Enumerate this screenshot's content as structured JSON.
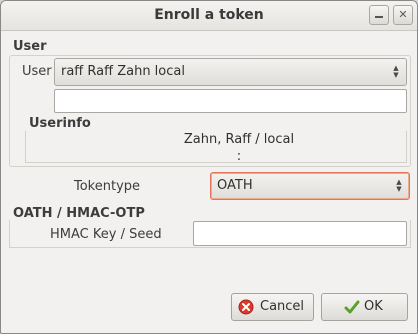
{
  "window": {
    "title": "Enroll a token"
  },
  "user_group": {
    "label": "User",
    "user_label": "User",
    "user_value": "raff Raff Zahn  local",
    "search_value": ""
  },
  "userinfo_group": {
    "label": "Userinfo",
    "line1": "Zahn, Raff / local",
    "line2": ":"
  },
  "tokentype": {
    "label": "Tokentype",
    "value": "OATH"
  },
  "oath_group": {
    "label": "OATH / HMAC-OTP",
    "hmac_label": "HMAC Key / Seed",
    "hmac_value": ""
  },
  "buttons": {
    "cancel": "Cancel",
    "ok": "OK"
  },
  "colors": {
    "focus_border": "#e0775a",
    "cancel_icon": "#d93a2b",
    "ok_icon": "#5aa02c"
  },
  "icons": {
    "cancel": "cancel-icon",
    "ok": "checkmark-icon",
    "minimize": "minimize-icon",
    "close": "close-icon"
  }
}
